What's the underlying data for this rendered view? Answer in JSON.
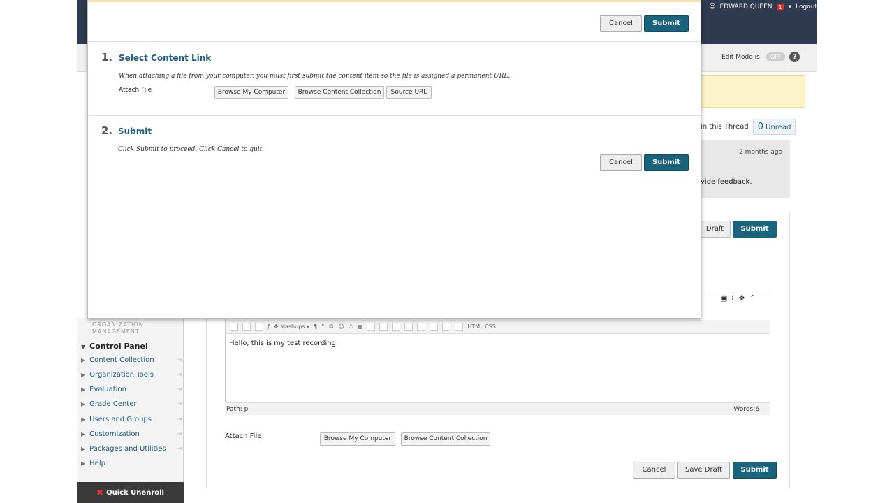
{
  "header": {
    "user_name": "EDWARD QUEEN",
    "notification_count": "1",
    "logout_label": "Logout",
    "edit_mode_label": "Edit Mode is:",
    "edit_mode_value": "OFF",
    "help_label": "?"
  },
  "thread": {
    "in_thread_text": "in this Thread",
    "unread_count": "0",
    "unread_label": "Unread",
    "message_age": "2 months ago",
    "message_snippet": "vide feedback."
  },
  "sidebar": {
    "org_management_label": "ORGANIZATION MANAGEMENT",
    "control_panel_label": "Control Panel",
    "items": [
      {
        "label": "Content Collection"
      },
      {
        "label": "Organization Tools"
      },
      {
        "label": "Evaluation"
      },
      {
        "label": "Grade Center"
      },
      {
        "label": "Users and Groups"
      },
      {
        "label": "Customization"
      },
      {
        "label": "Packages and Utilities"
      },
      {
        "label": "Help"
      }
    ],
    "quick_unenroll_label": "Quick Unenroll"
  },
  "reply_form": {
    "save_draft_top_label": "Draft",
    "submit_top_label": "Submit",
    "toolbar_mashups_label": "Mashups",
    "toolbar_html_label": "HTML CSS",
    "editor_text": "Hello, this is my test recording.",
    "path_label": "Path: p",
    "words_label": "Words:6",
    "attach_file_label": "Attach File",
    "browse_computer_label": "Browse My Computer",
    "browse_collection_label": "Browse Content Collection",
    "cancel_label": "Cancel",
    "save_draft_label": "Save Draft",
    "submit_label": "Submit"
  },
  "modal": {
    "cancel_top_label": "Cancel",
    "submit_top_label": "Submit",
    "step1_number": "1.",
    "step1_title": "Select Content Link",
    "step1_instructions": "When attaching a file from your computer, you must first submit the content item so the file is assigned a permanent URL.",
    "attach_file_label": "Attach File",
    "browse_computer_label": "Browse My Computer",
    "browse_collection_label": "Browse Content Collection",
    "source_url_label": "Source URL",
    "step2_number": "2.",
    "step2_title": "Submit",
    "step2_instructions": "Click Submit to proceed. Click Cancel to quit.",
    "cancel_bottom_label": "Cancel",
    "submit_bottom_label": "Submit"
  },
  "colors": {
    "primary_button": "#19637d",
    "link": "#1d5e87",
    "header_bg": "#2e3a4f",
    "banner_bg": "#fdf3c9"
  }
}
